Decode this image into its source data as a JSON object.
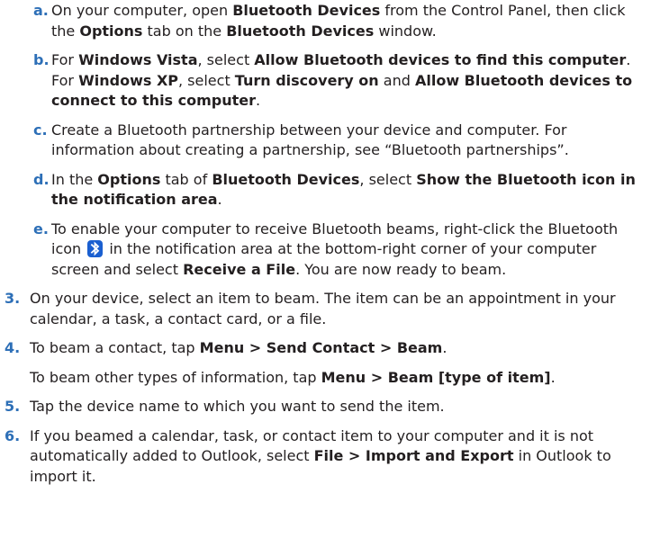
{
  "steps": {
    "a": {
      "marker": "a.",
      "t1": "On your computer, open ",
      "b1": "Bluetooth Devices",
      "t2": " from the Control Panel, then click the ",
      "b2": "Options",
      "t3": " tab on the ",
      "b3": "Bluetooth Devices",
      "t4": " window."
    },
    "b": {
      "marker": "b.",
      "t1": "For ",
      "b1": "Windows Vista",
      "t2": ", select ",
      "b2": "Allow Bluetooth devices to find this computer",
      "t3": ".",
      "p2t1": "For ",
      "p2b1": "Windows XP",
      "p2t2": ", select ",
      "p2b2": "Turn discovery on",
      "p2t3": " and ",
      "p2b3": "Allow Bluetooth devices to connect to this computer",
      "p2t4": "."
    },
    "c": {
      "marker": "c.",
      "t1": "Create a Bluetooth partnership between your device and computer. For information about creating a partnership, see “Bluetooth partnerships”."
    },
    "d": {
      "marker": "d.",
      "t1": "In the ",
      "b1": "Options",
      "t2": " tab of ",
      "b2": "Bluetooth Devices",
      "t3": ", select ",
      "b3": "Show the Bluetooth icon in the notification area",
      "t4": "."
    },
    "e": {
      "marker": "e.",
      "t1": "To enable your computer to receive Bluetooth beams, right-click the Bluetooth icon ",
      "icon": "bluetooth-icon",
      "t2": " in the notification area at the bottom-right corner of your computer screen and select ",
      "b1": "Receive a File",
      "t3": ". You are now ready to beam."
    },
    "s3": {
      "marker": "3.",
      "t1": "On your device, select an item to beam. The item can be an appointment in your calendar, a task, a contact card, or a file."
    },
    "s4": {
      "marker": "4.",
      "t1": "To beam a contact, tap ",
      "b1": "Menu > Send Contact > Beam",
      "t2": ".",
      "p2t1": "To beam other types of information, tap ",
      "p2b1": "Menu > Beam [type of item]",
      "p2t2": "."
    },
    "s5": {
      "marker": "5.",
      "t1": "Tap the device name to which you want to send the item."
    },
    "s6": {
      "marker": "6.",
      "t1": "If you beamed a calendar, task, or contact item to your computer and it is not automatically added to Outlook, select ",
      "b1": "File > Import and Export",
      "t2": " in Outlook to import it."
    }
  },
  "colors": {
    "marker": "#2d6fb7",
    "text": "#231f20",
    "icon_bg": "#1a5fd0"
  }
}
